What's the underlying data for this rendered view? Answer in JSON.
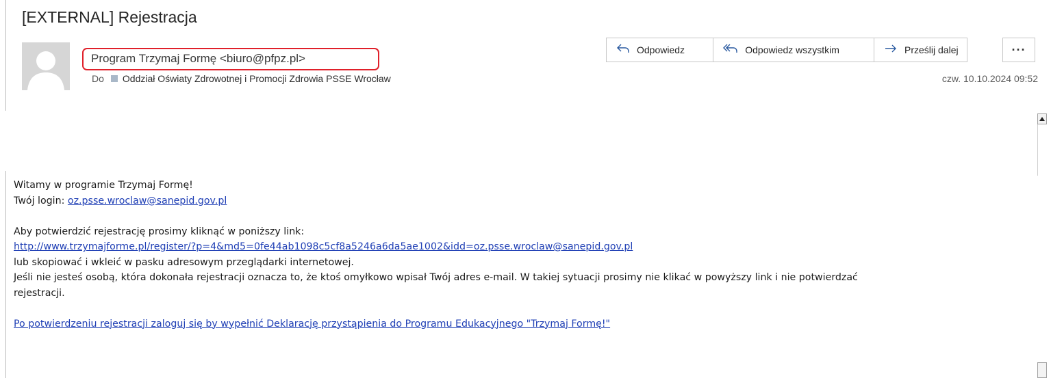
{
  "email": {
    "subject": "[EXTERNAL] Rejestracja",
    "sender": "Program Trzymaj Formę <biuro@pfpz.pl>",
    "to_label": "Do",
    "recipient": "Oddział Oświaty Zdrowotnej i Promocji Zdrowia PSSE Wrocław",
    "timestamp": "czw. 10.10.2024 09:52"
  },
  "actions": {
    "reply": "Odpowiedz",
    "reply_all": "Odpowiedz wszystkim",
    "forward": "Prześlij dalej",
    "more": "···"
  },
  "icons": {
    "reply": "reply-arrow-icon",
    "reply_all": "reply-all-arrow-icon",
    "forward": "forward-arrow-icon",
    "avatar": "person-silhouette-icon"
  },
  "body": {
    "line1": "Witamy w programie Trzymaj Formę!",
    "login_label": "Twój login: ",
    "login_link": "oz.psse.wroclaw@sanepid.gov.pl",
    "line3": "Aby potwierdzić rejestrację prosimy kliknąć w poniższy link:",
    "register_link": "http://www.trzymajforme.pl/register/?p=4&md5=0fe44ab1098c5cf8a5246a6da5ae1002&idd=oz.psse.wroclaw@sanepid.gov.pl",
    "line5": "lub skopiować i wkleić w pasku adresowym przeglądarki internetowej.",
    "line6": "Jeśli nie jesteś osobą, która dokonała rejestracji oznacza to, że ktoś omyłkowo wpisał Twój adres e-mail. W takiej sytuacji prosimy nie klikać w powyższy link i nie potwierdzać",
    "line7": "rejestracji.",
    "final_link": "Po potwierdzeniu rejestracji zaloguj się by wypełnić Deklarację przystąpienia do Programu Edukacyjnego \"Trzymaj Formę!\""
  },
  "colors": {
    "link": "#1f3fb5",
    "highlight_border": "#e0202a",
    "action_icon": "#2a5aa0"
  }
}
